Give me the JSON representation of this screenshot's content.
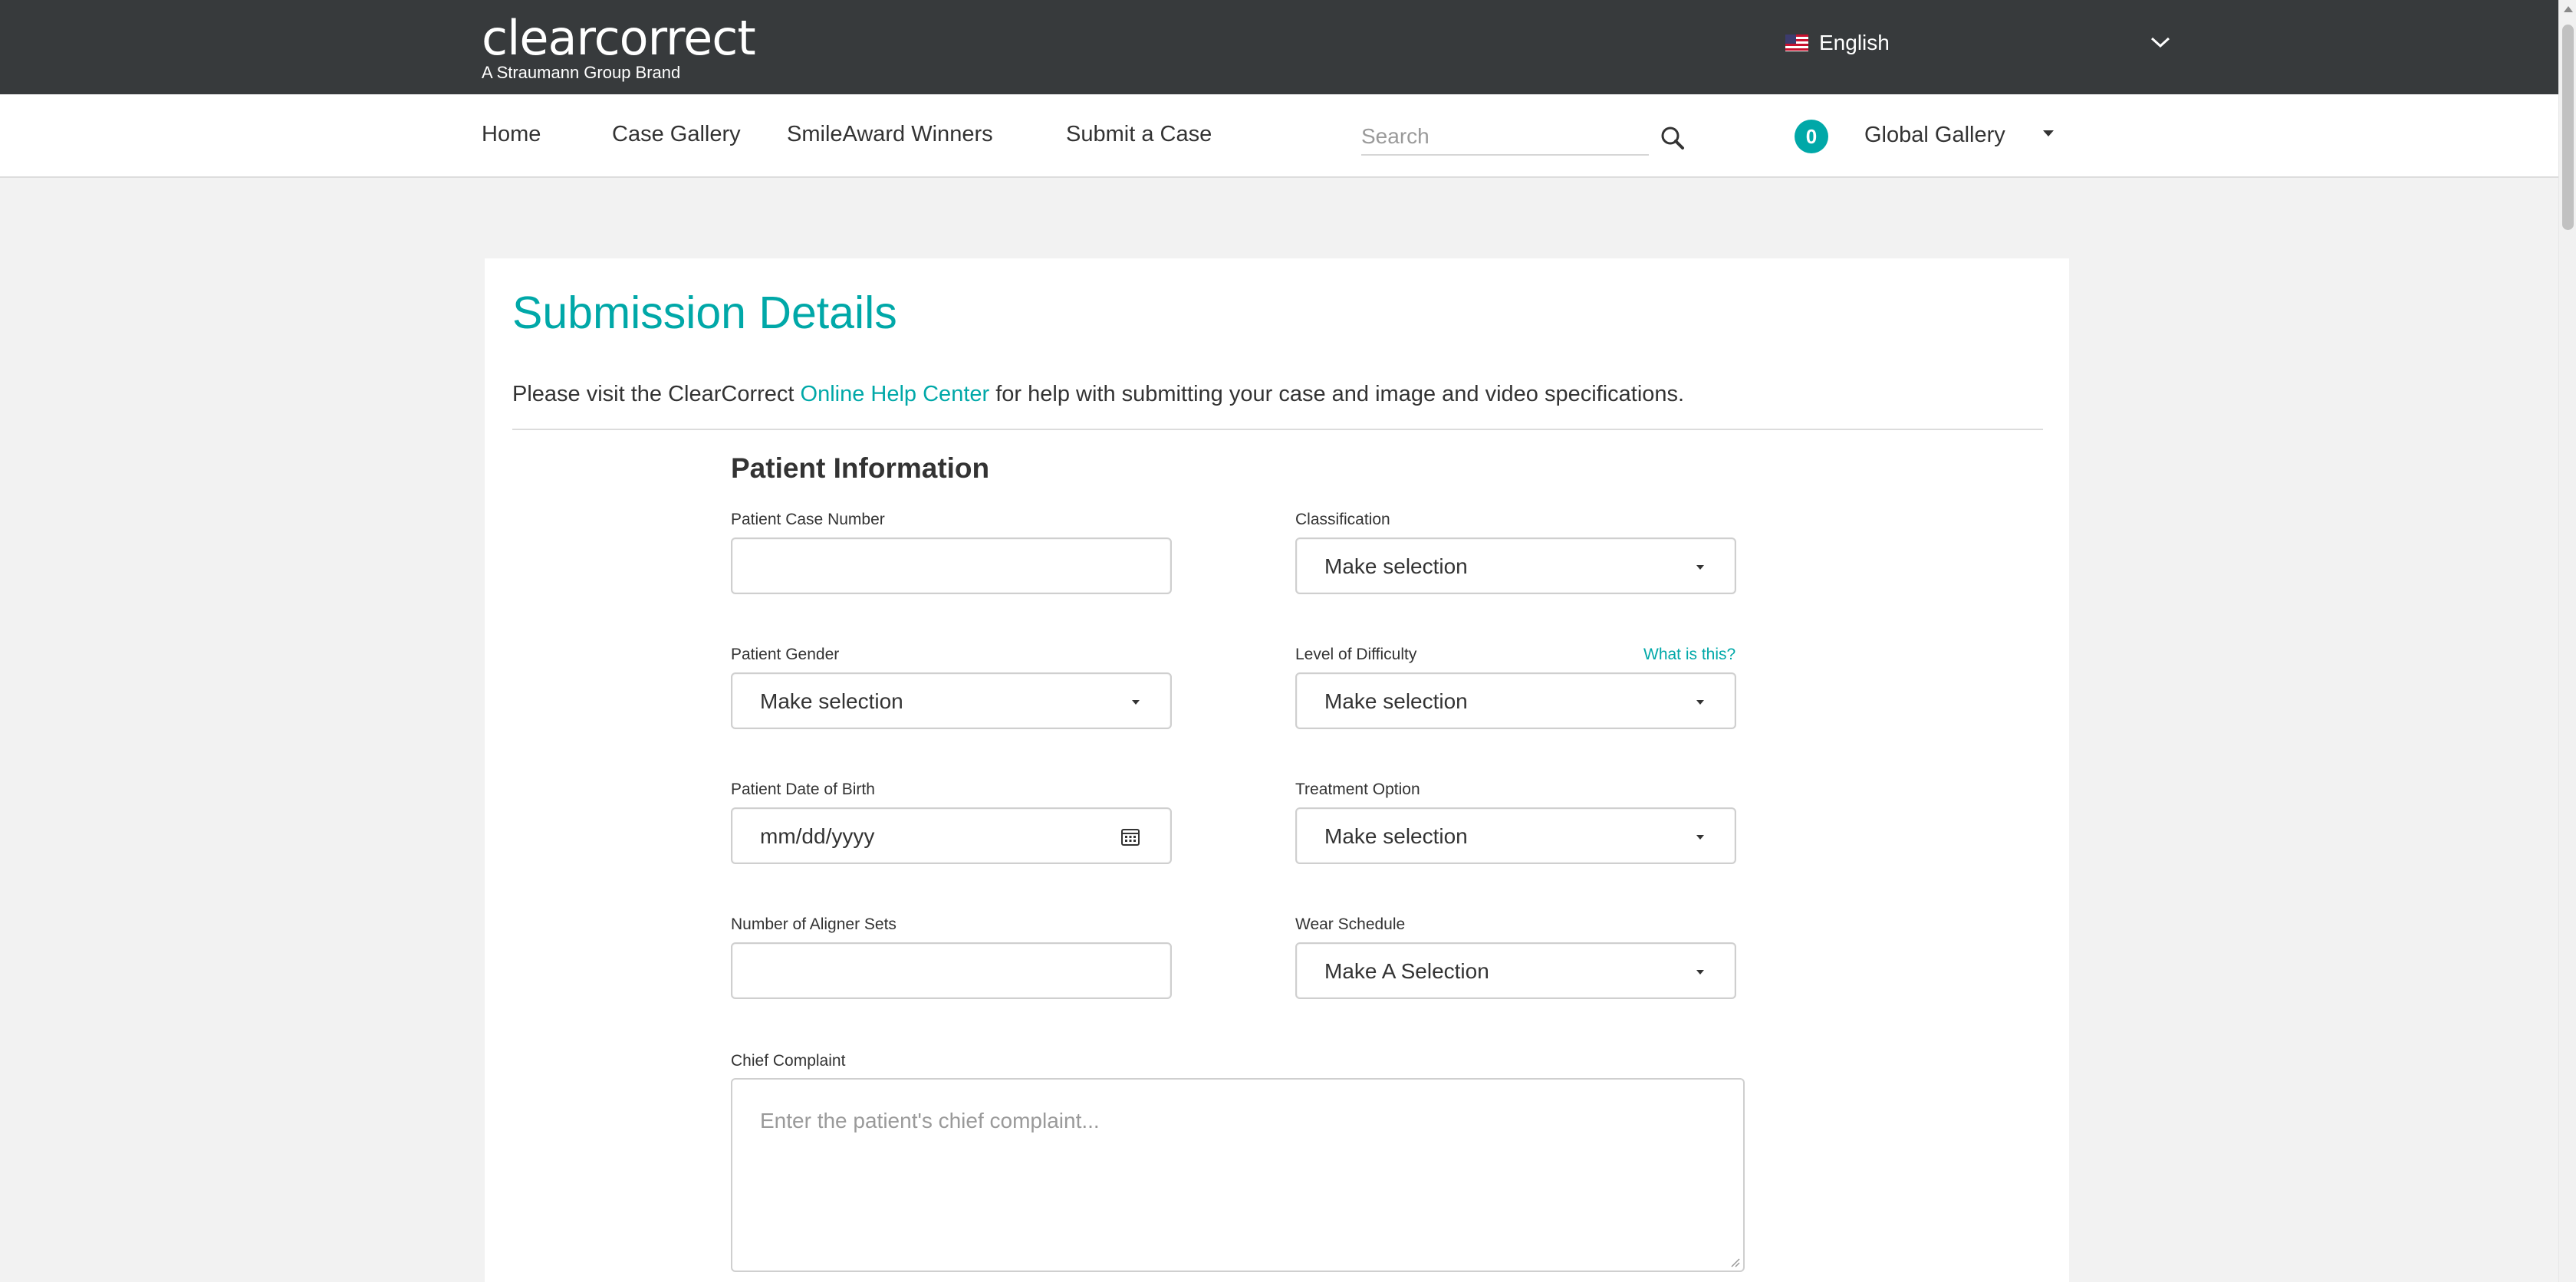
{
  "header": {
    "logo_text": "clearcorrect",
    "logo_tagline": "A Straumann Group Brand",
    "language": "English"
  },
  "nav": {
    "links": [
      "Home",
      "Case Gallery",
      "SmileAward Winners",
      "Submit a Case"
    ],
    "search_placeholder": "Search",
    "cart_count": "0",
    "gallery_label": "Global Gallery"
  },
  "page": {
    "title": "Submission Details",
    "intro_before": "Please visit the ClearCorrect ",
    "intro_link": "Online Help Center",
    "intro_after": " for help with submitting your case and image and video specifications."
  },
  "form": {
    "section_title": "Patient Information",
    "case_number": {
      "label": "Patient Case Number",
      "value": ""
    },
    "classification": {
      "label": "Classification",
      "value": "Make selection"
    },
    "gender": {
      "label": "Patient Gender",
      "value": "Make selection"
    },
    "difficulty": {
      "label": "Level of Difficulty",
      "value": "Make selection",
      "help": "What is this?"
    },
    "dob": {
      "label": "Patient Date of Birth",
      "value": "mm/dd/yyyy"
    },
    "treatment": {
      "label": "Treatment Option",
      "value": "Make selection"
    },
    "aligner_sets": {
      "label": "Number of Aligner Sets",
      "value": ""
    },
    "wear_schedule": {
      "label": "Wear Schedule",
      "value": "Make A Selection"
    },
    "chief_complaint": {
      "label": "Chief Complaint",
      "placeholder": "Enter the patient's chief complaint..."
    }
  },
  "colors": {
    "accent": "#00a8a8",
    "header_bg": "#373a3c",
    "page_bg": "#f2f2f2"
  }
}
